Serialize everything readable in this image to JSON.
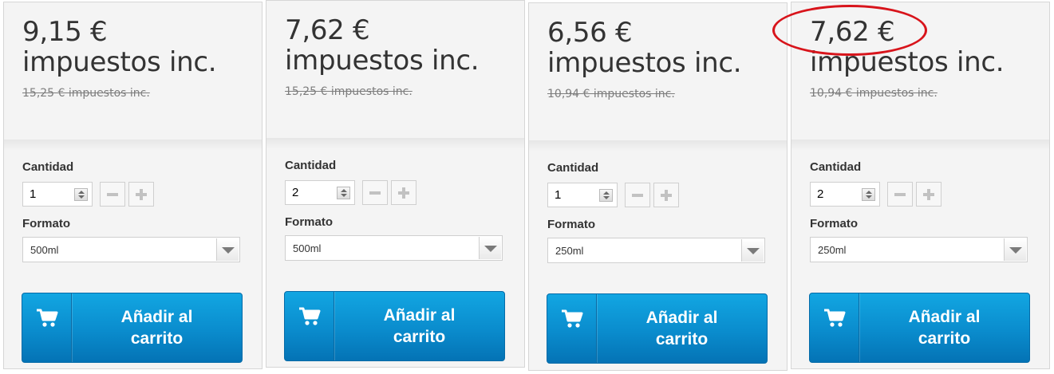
{
  "currency_note": "impuestos inc.",
  "products": [
    {
      "price": "9,15 €\nimpuestos inc.",
      "old_price": "15,25 € impuestos inc.",
      "quantity_label": "Cantidad",
      "quantity_value": "1",
      "format_label": "Formato",
      "format_value": "500ml",
      "cart_label": "Añadir al\ncarrito"
    },
    {
      "price": "7,62 €\nimpuestos inc.",
      "old_price": "15,25 € impuestos inc.",
      "quantity_label": "Cantidad",
      "quantity_value": "2",
      "format_label": "Formato",
      "format_value": "500ml",
      "cart_label": "Añadir al\ncarrito"
    },
    {
      "price": "6,56 €\nimpuestos inc.",
      "old_price": "10,94 € impuestos inc.",
      "quantity_label": "Cantidad",
      "quantity_value": "1",
      "format_label": "Formato",
      "format_value": "250ml",
      "cart_label": "Añadir al\ncarrito"
    },
    {
      "price": "7,62 €\nimpuestos inc.",
      "old_price": "10,94 € impuestos inc.",
      "quantity_label": "Cantidad",
      "quantity_value": "2",
      "format_label": "Formato",
      "format_value": "250ml",
      "cart_label": "Añadir al\ncarrito"
    }
  ],
  "icons": {
    "cart": "shopping-cart-icon",
    "minus": "minus-icon",
    "plus": "plus-icon",
    "dropdown": "chevron-down-icon",
    "spinner": "spinner-icon"
  },
  "colors": {
    "button_blue": "#0a8ccd",
    "highlight_red": "#d8141b",
    "card_bg": "#f4f4f4"
  }
}
